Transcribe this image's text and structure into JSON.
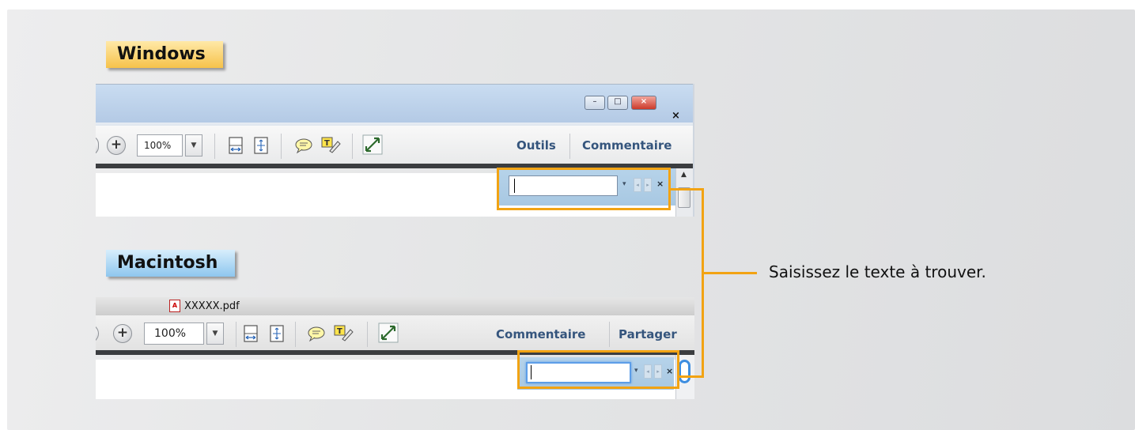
{
  "labels": {
    "windows": "Windows",
    "macintosh": "Macintosh",
    "callout": "Saisissez le texte à trouver."
  },
  "windows": {
    "zoom": "100%",
    "tools_link": "Outils",
    "comment_link": "Commentaire",
    "close_doc": "×",
    "caption_min": "–",
    "caption_max": "□",
    "caption_close": "×"
  },
  "mac": {
    "title": "XXXXX.pdf",
    "zoom": "100%",
    "comment_link": "Commentaire",
    "share_link": "Partager"
  },
  "find": {
    "value": "",
    "dropdown": "▾",
    "prev": "◂",
    "next": "▸",
    "close": "×"
  },
  "colors": {
    "highlight": "#f2a313",
    "windows_tag": "#f6c24a",
    "mac_tag": "#8ec6ee",
    "link": "#35557d"
  }
}
